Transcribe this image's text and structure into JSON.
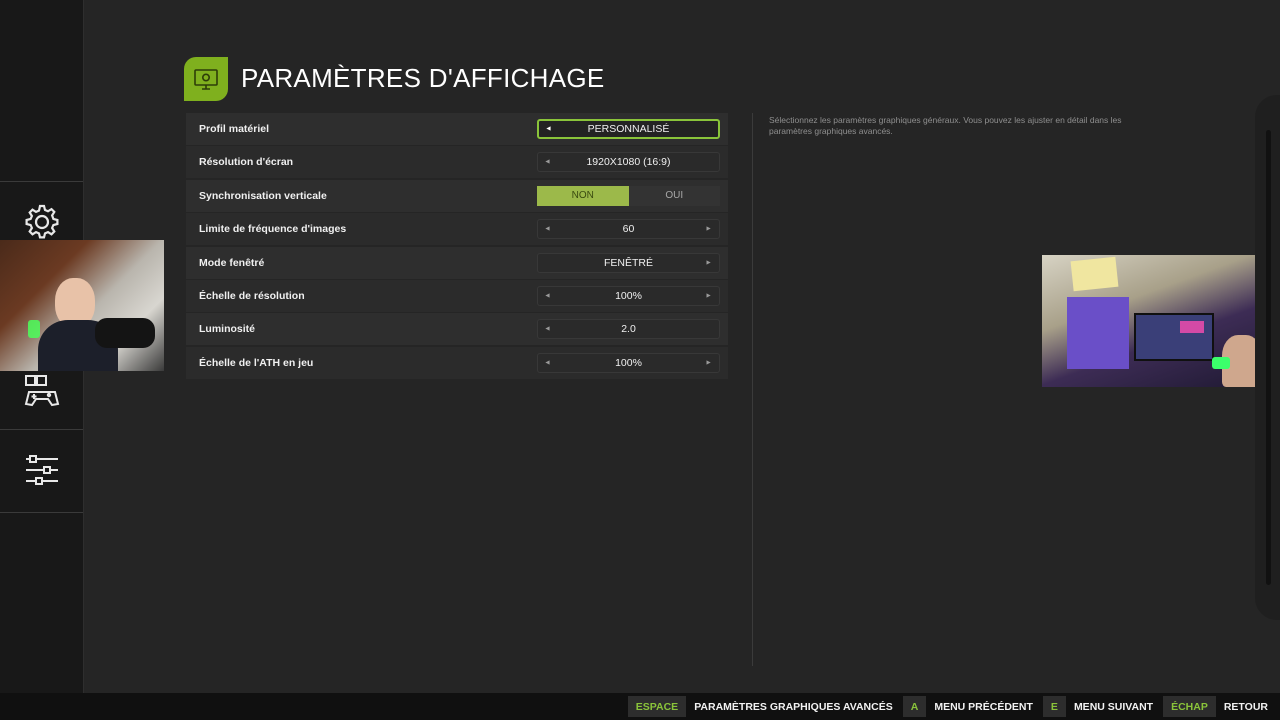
{
  "header": {
    "title": "PARAMÈTRES D'AFFICHAGE",
    "icon": "display-settings-icon",
    "accent_color": "#7fb01e"
  },
  "sidebar": {
    "items": [
      {
        "icon": "gear-icon"
      },
      {
        "icon": "gamepad-icon"
      },
      {
        "icon": "sliders-icon"
      }
    ]
  },
  "settings": [
    {
      "label": "Profil matériel",
      "value": "PERSONNALISÉ",
      "type": "selector",
      "left_arrow": "◄",
      "focused": true
    },
    {
      "label": "Résolution d'écran",
      "value": "1920X1080 (16:9)",
      "type": "selector",
      "left_arrow": "◄"
    },
    {
      "label": "Synchronisation verticale",
      "type": "toggle",
      "options": [
        "NON",
        "OUI"
      ],
      "selected": "NON"
    },
    {
      "label": "Limite de fréquence d'images",
      "value": "60",
      "type": "selector",
      "left_arrow": "◄",
      "right_arrow": "►"
    },
    {
      "label": "Mode fenêtré",
      "value": "FENÊTRÉ",
      "type": "selector",
      "right_arrow": "►"
    },
    {
      "label": "Échelle de résolution",
      "value": "100%",
      "type": "selector",
      "left_arrow": "◄",
      "right_arrow": "►"
    },
    {
      "label": "Luminosité",
      "value": "2.0",
      "type": "selector",
      "left_arrow": "◄"
    },
    {
      "label": "Échelle de l'ATH en jeu",
      "value": "100%",
      "type": "selector",
      "left_arrow": "◄",
      "right_arrow": "►"
    }
  ],
  "description": "Sélectionnez les paramètres graphiques généraux. Vous pouvez les ajuster en détail dans les paramètres graphiques avancés.",
  "footer": [
    {
      "key": "ESPACE",
      "label": "PARAMÈTRES GRAPHIQUES AVANCÉS"
    },
    {
      "key": "A",
      "label": "MENU PRÉCÉDENT"
    },
    {
      "key": "E",
      "label": "MENU SUIVANT"
    },
    {
      "key": "ÉCHAP",
      "label": "RETOUR"
    }
  ]
}
